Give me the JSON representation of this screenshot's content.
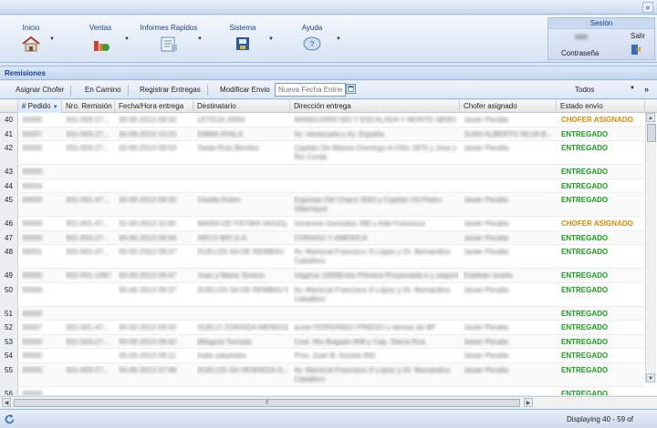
{
  "ribbon": {
    "items": [
      {
        "label": "Inicio",
        "icon": "home-icon"
      },
      {
        "label": "Ventas",
        "icon": "sales-chart-icon"
      },
      {
        "label": "Informes Rapidos",
        "icon": "report-icon"
      },
      {
        "label": "Sistema",
        "icon": "system-icon"
      },
      {
        "label": "Ayuda",
        "icon": "help-icon"
      }
    ]
  },
  "session": {
    "title": "Sesión",
    "password_label": "Contraseña",
    "exit_label": "Salir"
  },
  "panel": {
    "title": "Remisiones"
  },
  "toolbar": {
    "assign_driver": "Asignar Chofer",
    "on_the_way": "En Camino",
    "register_deliveries": "Registrar Entregas",
    "modify_shipment": "Modificar Envio",
    "new_delivery_date_placeholder": "Nueva Fecha Entrega",
    "filter_value": "Todos",
    "more": "»"
  },
  "grid": {
    "columns": [
      "# Pedido",
      "Nro. Remisión",
      "Fecha/Hora entrega",
      "Destinatario",
      "Dirección entrega",
      "Chofer asignado",
      "Estado envío"
    ],
    "rows": [
      {
        "n": "40",
        "pedido": "00000",
        "remision": "001-003-27...",
        "fecha": "00-00-2013 09:32",
        "dest": "LETICIA JARA",
        "dir": "MANDUVIRA 563 Y ESCALADA Y MONTE NEBO",
        "chofer": "Javier Peralta",
        "estado": "CHOFER ASIGNADO",
        "st": "chofer",
        "lines": 1
      },
      {
        "n": "41",
        "pedido": "00007",
        "remision": "001-003-27...",
        "fecha": "00-00-2013 10:22",
        "dest": "EMMA AYALA",
        "dir": "Av. Venezuela y Av. España",
        "chofer": "JUAN ALBERTO SILVA B...",
        "estado": "ENTREGADO",
        "st": "ok",
        "lines": 1
      },
      {
        "n": "42",
        "pedido": "00000",
        "remision": "001-003-27...",
        "fecha": "00-00-2013 09:53",
        "dest": "Saida Ruiz Benítez",
        "dir": "Capitán De Marina Domingo A Ortiz 1876 y Jose y Rio Corda",
        "chofer": "Javier Peralta",
        "estado": "ENTREGADO",
        "st": "ok",
        "lines": 2
      },
      {
        "n": "43",
        "pedido": "00000",
        "remision": "",
        "fecha": "",
        "dest": "",
        "dir": "",
        "chofer": "",
        "estado": "ENTREGADO",
        "st": "ok",
        "lines": 1
      },
      {
        "n": "44",
        "pedido": "00004",
        "remision": "",
        "fecha": "",
        "dest": "",
        "dir": "",
        "chofer": "",
        "estado": "ENTREGADO",
        "st": "ok",
        "lines": 1
      },
      {
        "n": "45",
        "pedido": "00003",
        "remision": "001-001-47...",
        "fecha": "00-00-2013 09:35",
        "dest": "Gisella Rolon",
        "dir": "Esposas Del Chaco 3063 y Capitán Gil Pedro Villamayor",
        "chofer": "Javier Peralta",
        "estado": "ENTREGADO",
        "st": "ok",
        "lines": 2
      },
      {
        "n": "46",
        "pedido": "00000",
        "remision": "001-001-47...",
        "fecha": "01-00-2013 11:00",
        "dest": "MARÍA DE FÁTIMA VAAZQ...",
        "dir": "Inmersos Gonzalez 390 y Ada Francisca",
        "chofer": "Javier Peralta",
        "estado": "CHOFER ASIGNADO",
        "st": "chofer",
        "lines": 1
      },
      {
        "n": "47",
        "pedido": "00000",
        "remision": "001-003-27...",
        "fecha": "00-00-2013 09:56",
        "dest": "ARCO BRI S.A.",
        "dir": "CORADO Y AMERICA",
        "chofer": "Javier Peralta",
        "estado": "ENTREGADO",
        "st": "ok",
        "lines": 1
      },
      {
        "n": "48",
        "pedido": "00001",
        "remision": "001-001-47...",
        "fecha": "00-00-2013 09:37",
        "dest": "DUELOS SA DE REMBAU",
        "dir": "Av. Mariscal Francisco S López y Dr. Bernardino Caballero",
        "chofer": "Javier Peralta",
        "estado": "ENTREGADO",
        "st": "ok",
        "lines": 2
      },
      {
        "n": "49",
        "pedido": "00000",
        "remision": "002-001-1497",
        "fecha": "00-00-2013 09:47",
        "dest": "Joan y Marie Tenece",
        "dir": "Viagnos 1000Entre Primera Proyectada e y segunda",
        "chofer": "Esteban ocarte",
        "estado": "ENTREGADO",
        "st": "ok",
        "lines": 1
      },
      {
        "n": "50",
        "pedido": "00006",
        "remision": "",
        "fecha": "00-00-2013 09:37",
        "dest": "DUELOS SA DE REMBAU DE S...",
        "dir": "Av. Mariscal Francisco S López y Dr. Bernardino Caballero",
        "chofer": "Javier Peralta",
        "estado": "ENTREGADO",
        "st": "ok",
        "lines": 2
      },
      {
        "n": "51",
        "pedido": "00000",
        "remision": "",
        "fecha": "",
        "dest": "",
        "dir": "",
        "chofer": "",
        "estado": "ENTREGADO",
        "st": "ok",
        "lines": 1
      },
      {
        "n": "52",
        "pedido": "00007",
        "remision": "001-001-47...",
        "fecha": "00-00-2013 09:42",
        "dest": "DUELO ZORAIDA MENDOZA...",
        "dir": "acote FERNANDO PINEDO y demas de 8P",
        "chofer": "Javier Peralta",
        "estado": "ENTREGADO",
        "st": "ok",
        "lines": 1
      },
      {
        "n": "53",
        "pedido": "00000",
        "remision": "001-003-27...",
        "fecha": "00-00-2013 09:42",
        "dest": "Milagros Torrada",
        "dir": "Cnel. Rio Bogado 808 y Cap. Sierra Roa",
        "chofer": "Javier Peralta",
        "estado": "ENTREGADO",
        "st": "ok",
        "lines": 1
      },
      {
        "n": "54",
        "pedido": "00000",
        "remision": "",
        "fecha": "00-00-2013 09:11",
        "dest": "Inala valuentes",
        "dir": "Prov. Juan B. Acosta 400",
        "chofer": "Javier Peralta",
        "estado": "ENTREGADO",
        "st": "ok",
        "lines": 1
      },
      {
        "n": "55",
        "pedido": "00000",
        "remision": "001-003-27...",
        "fecha": "00-00-2013 07:49",
        "dest": "DUELOS SA VENDEDA D...",
        "dir": "Av. Mariscal Francisco S López y Dr. Bernardino Caballero",
        "chofer": "Javier Peralta",
        "estado": "ENTREGADO",
        "st": "ok",
        "lines": 2
      },
      {
        "n": "56",
        "pedido": "00000",
        "remision": "",
        "fecha": "",
        "dest": "",
        "dir": "",
        "chofer": "",
        "estado": "ENTREGADO",
        "st": "ok",
        "lines": 1
      }
    ]
  },
  "statusbar": {
    "displaying": "Displaying 40 - 59 of"
  },
  "colors": {
    "accent": "#15428b",
    "delivered": "#15a21a",
    "assigned": "#e08a00"
  }
}
